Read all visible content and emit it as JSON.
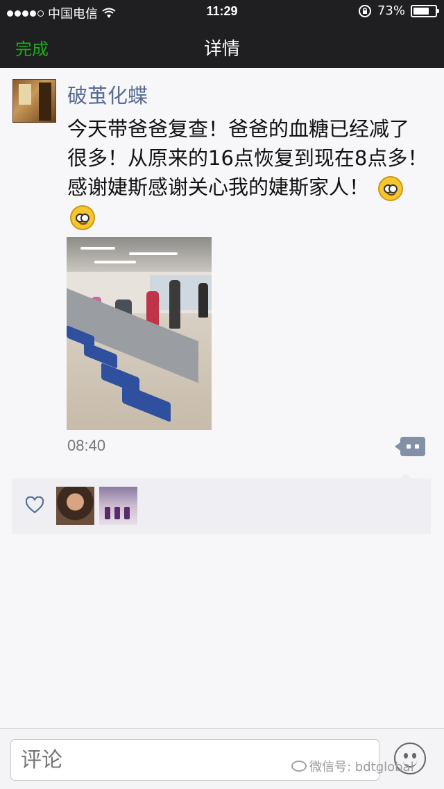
{
  "status_bar": {
    "carrier": "中国电信",
    "time": "11:29",
    "battery": "73%",
    "battery_level": 0.73,
    "icons": [
      "signal-dots-icon",
      "wifi-icon",
      "orientation-lock-icon",
      "battery-icon"
    ]
  },
  "nav": {
    "done_label": "完成",
    "title": "详情"
  },
  "post": {
    "username": "破茧化蝶",
    "text": "今天带爸爸复查！爸爸的血糖已经减了很多！从原来的16点恢复到现在8点多！感谢婕斯感谢关心我的婕斯家人！",
    "emojis": [
      "smile-emoji-icon",
      "smile-emoji-icon"
    ],
    "time": "08:40"
  },
  "likes": {
    "icon": "heart-outline-icon",
    "users": [
      "liker-avatar-1",
      "liker-avatar-2"
    ]
  },
  "bottom_bar": {
    "comment_placeholder": "评论",
    "watermark": "微信号: bdtglobal"
  },
  "colors": {
    "bar_bg": "#1f1f21",
    "done_green": "#1aad19",
    "username_blue": "#576b95",
    "page_bg": "#f7f7f9"
  }
}
